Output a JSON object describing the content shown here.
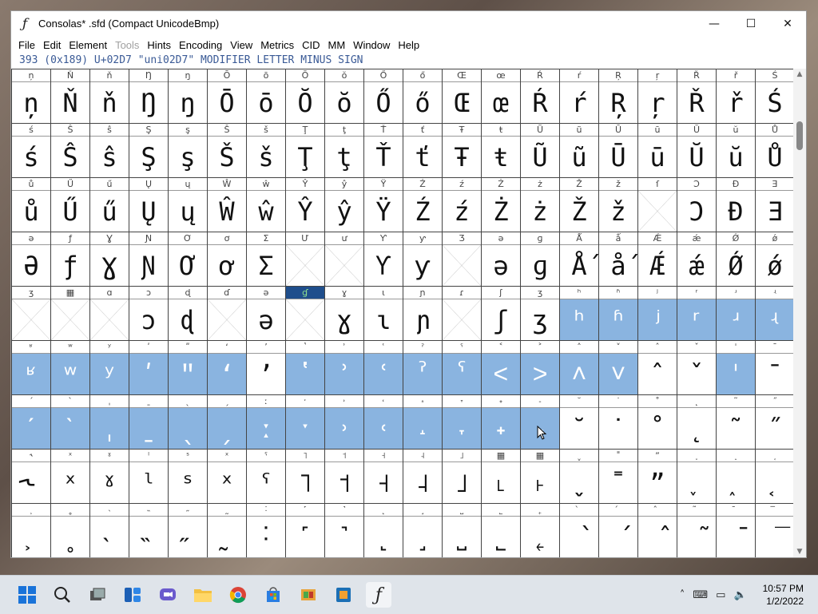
{
  "window": {
    "title": "Consolas* .sfd (Compact UnicodeBmp)",
    "minimize_icon": "minimize-icon",
    "maximize_icon": "maximize-icon",
    "close_icon": "close-icon",
    "min_glyph": "—",
    "max_glyph": "☐",
    "close_glyph": "✕"
  },
  "menu": [
    "File",
    "Edit",
    "Element",
    "Tools",
    "Hints",
    "Encoding",
    "View",
    "Metrics",
    "CID",
    "MM",
    "Window",
    "Help"
  ],
  "menu_disabled": [
    "Tools"
  ],
  "info": "393 (0x189) U+02D7 \"uni02D7\" MODIFIER LETTER MINUS SIGN",
  "colors": {
    "selection": "#8ab4e0",
    "current": "#1f4e8c",
    "info_text": "#3a5a96"
  },
  "rows": [
    [
      [
        "ņ",
        "ņ"
      ],
      [
        "Ň",
        "Ň"
      ],
      [
        "ň",
        "ň"
      ],
      [
        "Ŋ",
        "Ŋ"
      ],
      [
        "ŋ",
        "ŋ"
      ],
      [
        "Ō",
        "Ō"
      ],
      [
        "ō",
        "ō"
      ],
      [
        "Ŏ",
        "Ŏ"
      ],
      [
        "ŏ",
        "ŏ"
      ],
      [
        "Ő",
        "Ő"
      ],
      [
        "ő",
        "ő"
      ],
      [
        "Œ",
        "Œ"
      ],
      [
        "œ",
        "œ"
      ],
      [
        "Ŕ",
        "Ŕ"
      ],
      [
        "ŕ",
        "ŕ"
      ],
      [
        "Ŗ",
        "Ŗ"
      ],
      [
        "ŗ",
        "ŗ"
      ],
      [
        "Ř",
        "Ř"
      ],
      [
        "ř",
        "ř"
      ],
      [
        "Ś",
        "Ś"
      ]
    ],
    [
      [
        "ś",
        "ś"
      ],
      [
        "Ŝ",
        "Ŝ"
      ],
      [
        "ŝ",
        "ŝ"
      ],
      [
        "Ş",
        "Ş"
      ],
      [
        "ş",
        "ş"
      ],
      [
        "Š",
        "Š"
      ],
      [
        "š",
        "š"
      ],
      [
        "Ţ",
        "Ţ"
      ],
      [
        "ţ",
        "ţ"
      ],
      [
        "Ť",
        "Ť"
      ],
      [
        "ť",
        "ť"
      ],
      [
        "Ŧ",
        "Ŧ"
      ],
      [
        "ŧ",
        "ŧ"
      ],
      [
        "Ũ",
        "Ũ"
      ],
      [
        "ũ",
        "ũ"
      ],
      [
        "Ū",
        "Ū"
      ],
      [
        "ū",
        "ū"
      ],
      [
        "Ŭ",
        "Ŭ"
      ],
      [
        "ŭ",
        "ŭ"
      ],
      [
        "Ů",
        "Ů"
      ]
    ],
    [
      [
        "ů",
        "ů"
      ],
      [
        "Ű",
        "Ű"
      ],
      [
        "ű",
        "ű"
      ],
      [
        "Ų",
        "Ų"
      ],
      [
        "ų",
        "ų"
      ],
      [
        "Ŵ",
        "Ŵ"
      ],
      [
        "ŵ",
        "ŵ"
      ],
      [
        "Ŷ",
        "Ŷ"
      ],
      [
        "ŷ",
        "ŷ"
      ],
      [
        "Ÿ",
        "Ÿ"
      ],
      [
        "Ź",
        "Ź"
      ],
      [
        "ź",
        "ź"
      ],
      [
        "Ż",
        "Ż"
      ],
      [
        "ż",
        "ż"
      ],
      [
        "Ž",
        "Ž"
      ],
      [
        "ž",
        "ž"
      ],
      [
        "ſ",
        ""
      ],
      [
        "Ɔ",
        "Ɔ"
      ],
      [
        "Đ",
        "Đ"
      ],
      [
        "Ǝ",
        "Ǝ"
      ]
    ],
    [
      [
        "ə",
        "Ə"
      ],
      [
        "ƒ",
        "ƒ"
      ],
      [
        "Ɣ",
        "Ɣ"
      ],
      [
        "Ɲ",
        "Ɲ"
      ],
      [
        "Ơ",
        "Ơ"
      ],
      [
        "ơ",
        "ơ"
      ],
      [
        "Ʃ",
        "Ʃ"
      ],
      [
        "Ư",
        ""
      ],
      [
        "ư",
        ""
      ],
      [
        "Ƴ",
        "Ƴ"
      ],
      [
        "ƴ",
        "ƴ"
      ],
      [
        "Ʒ",
        ""
      ],
      [
        "ə",
        "ə"
      ],
      [
        "ɡ",
        "ɡ"
      ],
      [
        "Ǻ",
        "Ǻ"
      ],
      [
        "ǻ",
        "ǻ"
      ],
      [
        "Ǽ",
        "Ǽ"
      ],
      [
        "ǽ",
        "ǽ"
      ],
      [
        "Ǿ",
        "Ǿ"
      ],
      [
        "ǿ",
        "ǿ"
      ]
    ],
    [
      [
        "ʒ",
        ""
      ],
      [
        "▦",
        ""
      ],
      [
        "ɑ",
        ""
      ],
      [
        "ɔ",
        "ɔ"
      ],
      [
        "ɖ",
        "ɖ"
      ],
      [
        "ɗ",
        ""
      ],
      [
        "ə",
        "ə"
      ],
      [
        "ɠ",
        ""
      ],
      [
        "ɣ",
        "ɣ"
      ],
      [
        "ɩ",
        "ɩ"
      ],
      [
        "ɲ",
        "ɲ"
      ],
      [
        "ɾ",
        ""
      ],
      [
        "ʃ",
        "ʃ"
      ],
      [
        "ʒ",
        "ʒ"
      ],
      [
        "ʰ",
        "ʰ"
      ],
      [
        "ʱ",
        "ʱ"
      ],
      [
        "ʲ",
        "ʲ"
      ],
      [
        "ʳ",
        "ʳ"
      ],
      [
        "ʴ",
        "ʴ"
      ],
      [
        "ʵ",
        "ʵ"
      ]
    ],
    [
      [
        "ʶ",
        "ʶ"
      ],
      [
        "ʷ",
        "ʷ"
      ],
      [
        "ʸ",
        "ʸ"
      ],
      [
        "ʹ",
        "ʹ"
      ],
      [
        "ʺ",
        "ʺ"
      ],
      [
        "ʻ",
        "ʻ"
      ],
      [
        "ʼ",
        "ʼ"
      ],
      [
        "ʽ",
        "ʽ"
      ],
      [
        "ʾ",
        "ʾ"
      ],
      [
        "ʿ",
        "ʿ"
      ],
      [
        "ˀ",
        "ˀ"
      ],
      [
        "ˁ",
        "ˁ"
      ],
      [
        "˂",
        "˂"
      ],
      [
        "˃",
        "˃"
      ],
      [
        "˄",
        "˄"
      ],
      [
        "˅",
        "˅"
      ],
      [
        "ˆ",
        "ˆ"
      ],
      [
        "ˇ",
        "ˇ"
      ],
      [
        "ˈ",
        "ˈ"
      ],
      [
        "ˉ",
        "ˉ"
      ]
    ],
    [
      [
        "ˊ",
        "ˊ"
      ],
      [
        "ˋ",
        "ˋ"
      ],
      [
        "ˌ",
        "ˌ"
      ],
      [
        "ˍ",
        "ˍ"
      ],
      [
        "ˎ",
        "ˎ"
      ],
      [
        "ˏ",
        "ˏ"
      ],
      [
        "ː",
        "ː"
      ],
      [
        "ˑ",
        "ˑ"
      ],
      [
        "˒",
        "˒"
      ],
      [
        "˓",
        "˓"
      ],
      [
        "˔",
        "˔"
      ],
      [
        "˕",
        "˕"
      ],
      [
        "˖",
        "˖"
      ],
      [
        "˗",
        "˗"
      ],
      [
        "˘",
        "˘"
      ],
      [
        "˙",
        "˙"
      ],
      [
        "˚",
        "˚"
      ],
      [
        "˛",
        "˛"
      ],
      [
        "˜",
        "˜"
      ],
      [
        "˝",
        "˝"
      ]
    ],
    [
      [
        "˞",
        "˞"
      ],
      [
        "ˣ",
        "ˣ"
      ],
      [
        "ˠ",
        "ˠ"
      ],
      [
        "ˡ",
        "ˡ"
      ],
      [
        "ˢ",
        "ˢ"
      ],
      [
        "ˣ",
        "ˣ"
      ],
      [
        "ˤ",
        "ˤ"
      ],
      [
        "˥",
        "˥"
      ],
      [
        "˦",
        "˦"
      ],
      [
        "˧",
        "˧"
      ],
      [
        "˨",
        "˨"
      ],
      [
        "˩",
        "˩"
      ],
      [
        "▦",
        "˪"
      ],
      [
        "▦",
        "˫"
      ],
      [
        "ˬ",
        "ˬ"
      ],
      [
        "˭",
        "˭"
      ],
      [
        "ˮ",
        "ˮ"
      ],
      [
        "˯",
        "˯"
      ],
      [
        "˰",
        "˰"
      ],
      [
        "˱",
        "˱"
      ]
    ],
    [
      [
        "˲",
        "˲"
      ],
      [
        "˳",
        "˳"
      ],
      [
        "˴",
        "˴"
      ],
      [
        "˵",
        "˵"
      ],
      [
        "˶",
        "˶"
      ],
      [
        "˷",
        "˷"
      ],
      [
        "˸",
        "˸"
      ],
      [
        "˹",
        "˹"
      ],
      [
        "˺",
        "˺"
      ],
      [
        "˻",
        "˻"
      ],
      [
        "˼",
        "˼"
      ],
      [
        "˽",
        "˽"
      ],
      [
        "˾",
        "˾"
      ],
      [
        "˿",
        "˿"
      ],
      [
        "̀",
        "̀"
      ],
      [
        "́",
        "́"
      ],
      [
        "̂",
        "̂"
      ],
      [
        "̃",
        "̃"
      ],
      [
        "̄",
        "̄"
      ],
      [
        "̅",
        "̅"
      ]
    ]
  ],
  "taskbar": {
    "icons": [
      "windows-start-icon",
      "search-icon",
      "task-view-icon",
      "widgets-icon",
      "teams-chat-icon",
      "file-explorer-icon",
      "chrome-icon",
      "microsoft-store-icon",
      "app-icon",
      "app-icon",
      "fontforge-icon"
    ],
    "time": "10:57 PM",
    "date": "1/2/2022"
  }
}
